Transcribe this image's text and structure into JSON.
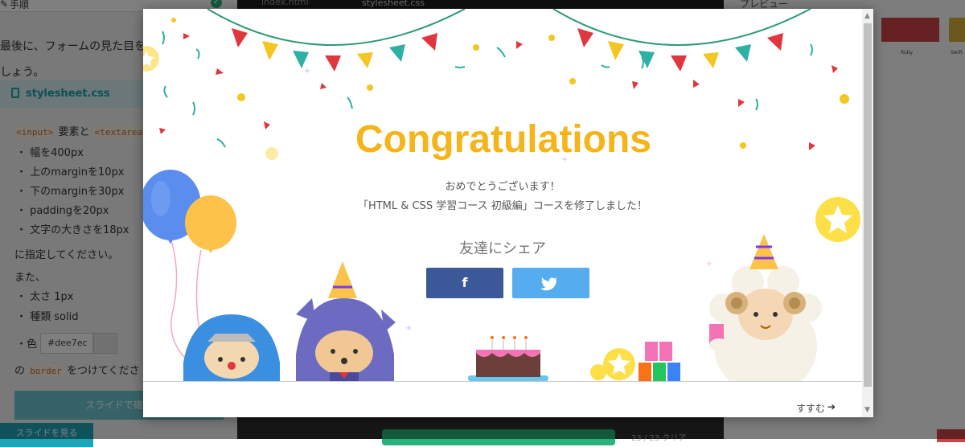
{
  "steps": {
    "title": "手順",
    "intro_line1": "最後に、フォームの見た目を整",
    "intro_line2": "しょう。",
    "file_name": "stylesheet.css",
    "code_input": "<input>",
    "conj_text": "要素と",
    "code_textarea": "<textarea>",
    "bullets": [
      "・ 幅を400px",
      "・ 上のmarginを10px",
      "・ 下のmarginを30px",
      "・ paddingを20px",
      "・ 文字の大きさを18px"
    ],
    "specify_text": "に指定してください。",
    "also_text": "また、",
    "bullets2": [
      "・ 太さ 1px",
      "・ 種類 solid"
    ],
    "color_label": "・色",
    "color_value": "#dee7ec",
    "no_text": "の",
    "code_border": "border",
    "attach_text": "をつけてくださ",
    "slide_confirm_label": "スライドで確認",
    "slide_view_label": "スライドを見る"
  },
  "editor": {
    "tab_html": "index.html",
    "tab_css": "stylesheet.css",
    "progress_text": "23 / 23 クリア"
  },
  "preview": {
    "title": "プレビュー",
    "item1": "Ruby",
    "item2": "Swift"
  },
  "modal": {
    "heading": "Congratulations",
    "message_line1": "おめでとうございます！",
    "message_line2": "「HTML & CSS 学習コース 初級編」コースを修了しました！",
    "share_label": "友達にシェア",
    "facebook_icon": "f",
    "next_label": "すすむ",
    "next_arrow_icon": "arrow-right",
    "heading_color": "#f5b41a",
    "facebook_color": "#3b5998",
    "twitter_color": "#55acee"
  }
}
